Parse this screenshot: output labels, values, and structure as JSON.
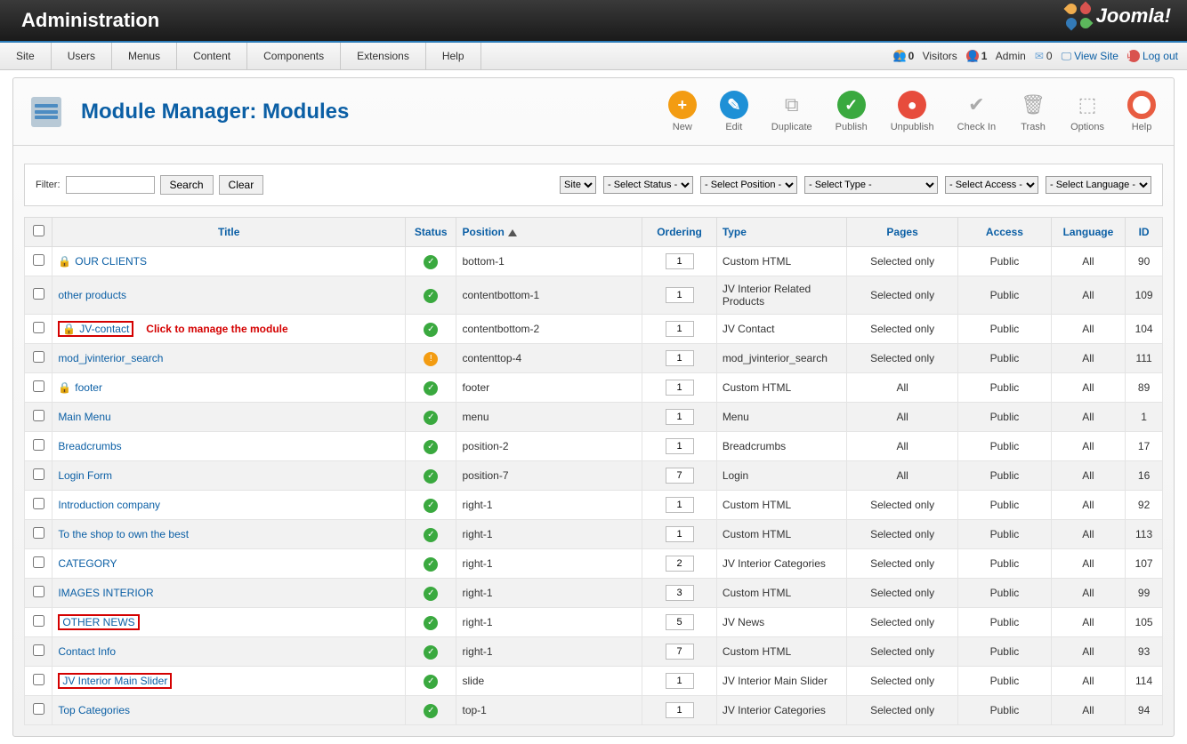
{
  "header": {
    "title": "Administration",
    "brand": "Joomla!"
  },
  "menubar": {
    "items": [
      "Site",
      "Users",
      "Menus",
      "Content",
      "Components",
      "Extensions",
      "Help"
    ],
    "status": {
      "visitors_count": "0",
      "visitors_label": "Visitors",
      "admin_count": "1",
      "admin_label": "Admin",
      "msg_count": "0",
      "view_site": "View Site",
      "logout": "Log out"
    }
  },
  "page": {
    "title": "Module Manager: Modules"
  },
  "toolbar": [
    {
      "id": "new",
      "label": "New"
    },
    {
      "id": "edit",
      "label": "Edit"
    },
    {
      "id": "duplicate",
      "label": "Duplicate"
    },
    {
      "id": "publish",
      "label": "Publish"
    },
    {
      "id": "unpublish",
      "label": "Unpublish"
    },
    {
      "id": "checkin",
      "label": "Check In"
    },
    {
      "id": "trash",
      "label": "Trash"
    },
    {
      "id": "options",
      "label": "Options"
    },
    {
      "id": "help",
      "label": "Help"
    }
  ],
  "filter": {
    "label": "Filter:",
    "search": "Search",
    "clear": "Clear",
    "selects": [
      "Site",
      "- Select Status -",
      "- Select Position -",
      "- Select Type -",
      "- Select Access -",
      "- Select Language -"
    ]
  },
  "columns": [
    "Title",
    "Status",
    "Position",
    "Ordering",
    "Type",
    "Pages",
    "Access",
    "Language",
    "ID"
  ],
  "annotation": "Click to manage the module",
  "rows": [
    {
      "locked": true,
      "title": "OUR CLIENTS",
      "status": "on",
      "position": "bottom-1",
      "ordering": "1",
      "type": "Custom HTML",
      "pages": "Selected only",
      "access": "Public",
      "language": "All",
      "id": "90"
    },
    {
      "locked": false,
      "title": "other products",
      "status": "on",
      "position": "contentbottom-1",
      "ordering": "1",
      "type": "JV Interior Related Products",
      "pages": "Selected only",
      "access": "Public",
      "language": "All",
      "id": "109"
    },
    {
      "locked": true,
      "title": "JV-contact",
      "status": "on",
      "position": "contentbottom-2",
      "ordering": "1",
      "type": "JV Contact",
      "pages": "Selected only",
      "access": "Public",
      "language": "All",
      "id": "104",
      "redbox": true,
      "ann": true
    },
    {
      "locked": false,
      "title": "mod_jvinterior_search",
      "status": "warn",
      "position": "contenttop-4",
      "ordering": "1",
      "type": "mod_jvinterior_search",
      "pages": "Selected only",
      "access": "Public",
      "language": "All",
      "id": "111"
    },
    {
      "locked": true,
      "title": "footer",
      "status": "on",
      "position": "footer",
      "ordering": "1",
      "type": "Custom HTML",
      "pages": "All",
      "access": "Public",
      "language": "All",
      "id": "89"
    },
    {
      "locked": false,
      "title": "Main Menu",
      "status": "on",
      "position": "menu",
      "ordering": "1",
      "type": "Menu",
      "pages": "All",
      "access": "Public",
      "language": "All",
      "id": "1"
    },
    {
      "locked": false,
      "title": "Breadcrumbs",
      "status": "on",
      "position": "position-2",
      "ordering": "1",
      "type": "Breadcrumbs",
      "pages": "All",
      "access": "Public",
      "language": "All",
      "id": "17"
    },
    {
      "locked": false,
      "title": "Login Form",
      "status": "on",
      "position": "position-7",
      "ordering": "7",
      "type": "Login",
      "pages": "All",
      "access": "Public",
      "language": "All",
      "id": "16"
    },
    {
      "locked": false,
      "title": "Introduction company",
      "status": "on",
      "position": "right-1",
      "ordering": "1",
      "type": "Custom HTML",
      "pages": "Selected only",
      "access": "Public",
      "language": "All",
      "id": "92"
    },
    {
      "locked": false,
      "title": "To the shop to own the best",
      "status": "on",
      "position": "right-1",
      "ordering": "1",
      "type": "Custom HTML",
      "pages": "Selected only",
      "access": "Public",
      "language": "All",
      "id": "113"
    },
    {
      "locked": false,
      "title": "CATEGORY",
      "status": "on",
      "position": "right-1",
      "ordering": "2",
      "type": "JV Interior Categories",
      "pages": "Selected only",
      "access": "Public",
      "language": "All",
      "id": "107"
    },
    {
      "locked": false,
      "title": "IMAGES INTERIOR",
      "status": "on",
      "position": "right-1",
      "ordering": "3",
      "type": "Custom HTML",
      "pages": "Selected only",
      "access": "Public",
      "language": "All",
      "id": "99"
    },
    {
      "locked": false,
      "title": "OTHER NEWS",
      "status": "on",
      "position": "right-1",
      "ordering": "5",
      "type": "JV News",
      "pages": "Selected only",
      "access": "Public",
      "language": "All",
      "id": "105",
      "redbox": true
    },
    {
      "locked": false,
      "title": "Contact Info",
      "status": "on",
      "position": "right-1",
      "ordering": "7",
      "type": "Custom HTML",
      "pages": "Selected only",
      "access": "Public",
      "language": "All",
      "id": "93"
    },
    {
      "locked": false,
      "title": "JV Interior Main Slider",
      "status": "on",
      "position": "slide",
      "ordering": "1",
      "type": "JV Interior Main Slider",
      "pages": "Selected only",
      "access": "Public",
      "language": "All",
      "id": "114",
      "redbox": true
    },
    {
      "locked": false,
      "title": "Top Categories",
      "status": "on",
      "position": "top-1",
      "ordering": "1",
      "type": "JV Interior Categories",
      "pages": "Selected only",
      "access": "Public",
      "language": "All",
      "id": "94"
    }
  ]
}
